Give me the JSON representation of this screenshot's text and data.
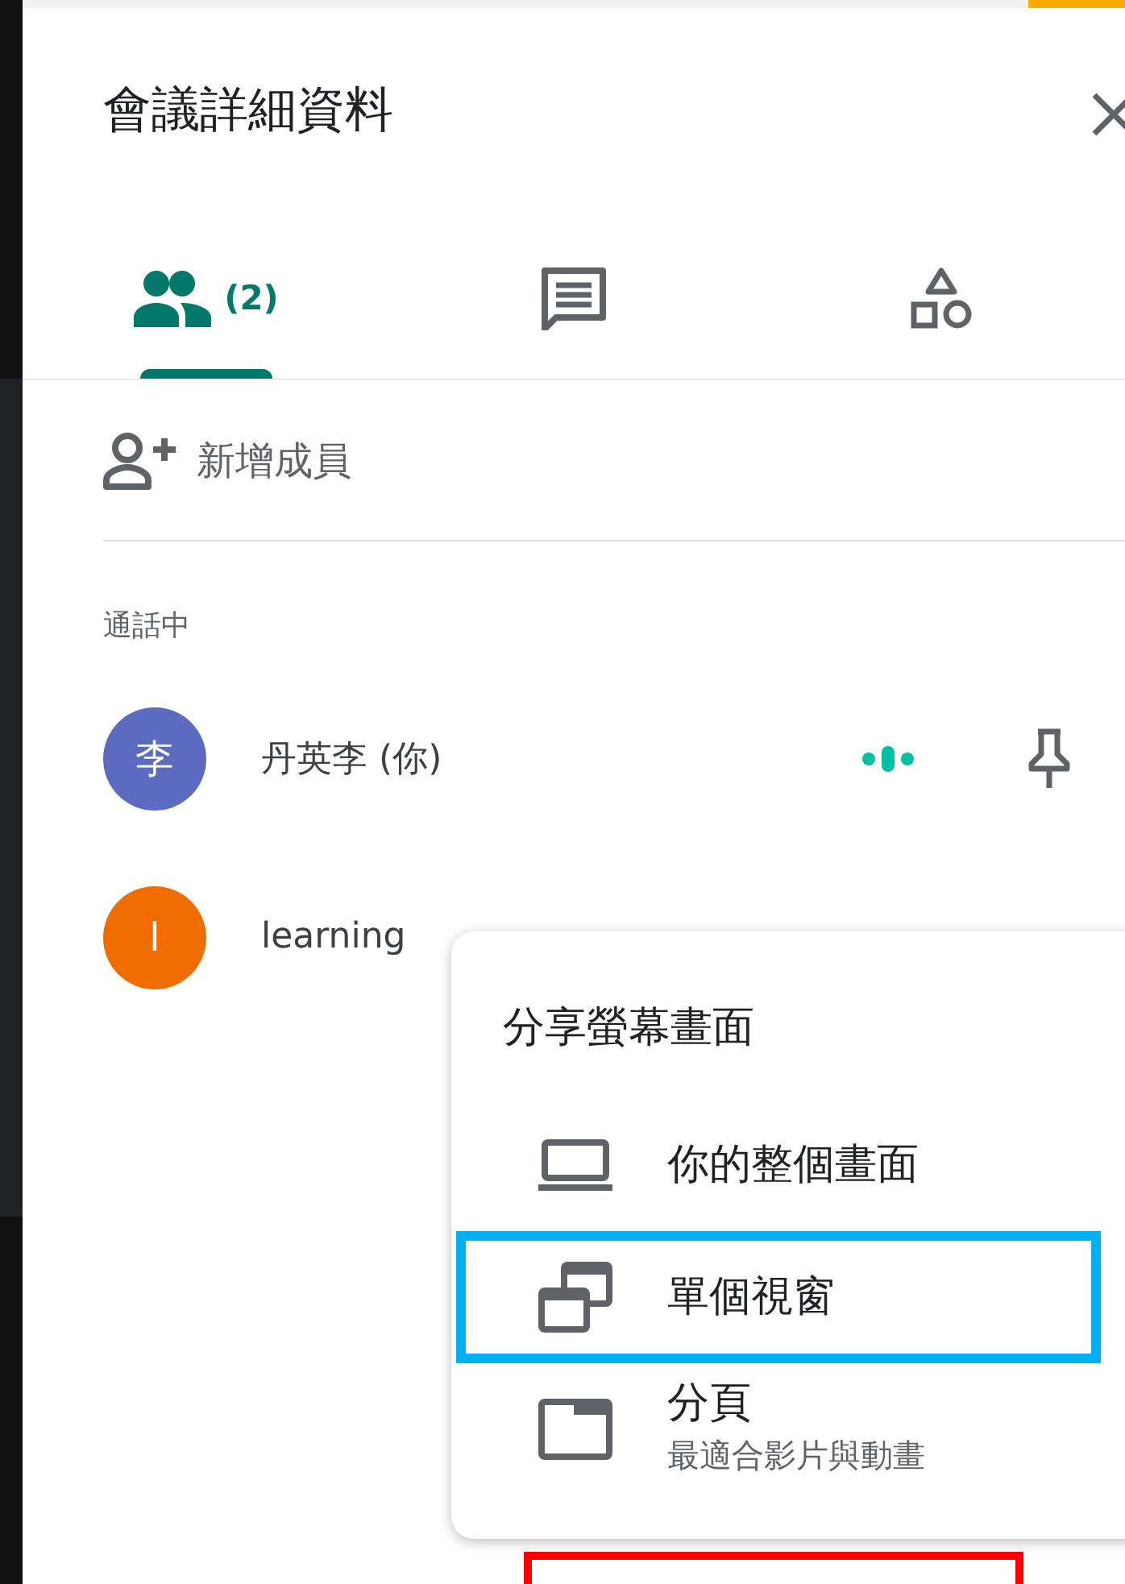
{
  "panel": {
    "title": "會議詳細資料"
  },
  "tabs": [
    {
      "kind": "people",
      "count": "(2)",
      "selected": true
    },
    {
      "kind": "chat",
      "selected": false
    },
    {
      "kind": "activities",
      "selected": false
    }
  ],
  "add_member": {
    "label": "新增成員"
  },
  "section": {
    "label": "通話中"
  },
  "participants": [
    {
      "initial": "李",
      "name": "丹英李 (你)",
      "color": "#5c6bc0",
      "speaking": true,
      "pin": true
    },
    {
      "initial": "l",
      "name": "learning",
      "color": "#ef6c00",
      "speaking": false,
      "pin": false
    }
  ],
  "share_menu": {
    "title": "分享螢幕畫面",
    "items": [
      {
        "kind": "screen",
        "label": "你的整個畫面",
        "selected": false
      },
      {
        "kind": "window",
        "label": "單個視窗",
        "selected": true
      },
      {
        "kind": "tab",
        "label": "分頁",
        "subtitle": "最適合影片與動畫",
        "selected": false
      }
    ]
  }
}
